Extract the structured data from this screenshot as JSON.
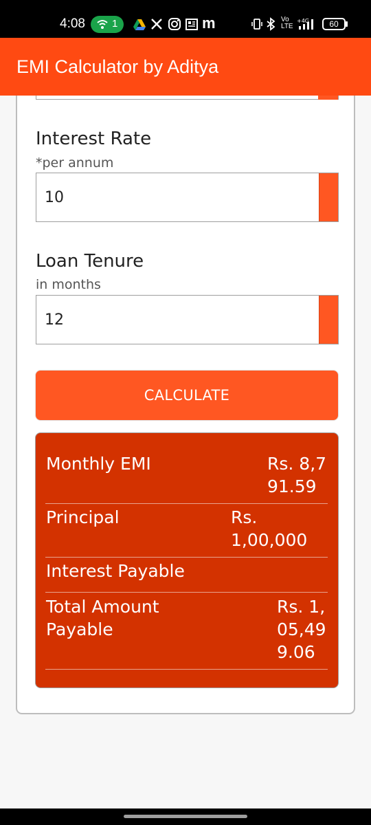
{
  "status_bar": {
    "time": "4:08",
    "wifi_count": "1",
    "battery": "60",
    "icons": [
      "wifi-icon",
      "drive-icon",
      "x-icon",
      "instagram-icon",
      "news-icon",
      "m-icon",
      "vibrate-icon",
      "bluetooth-icon",
      "volte-icon",
      "signal-icon",
      "battery-icon"
    ]
  },
  "app_bar": {
    "title": "EMI Calculator by Aditya"
  },
  "form": {
    "interest": {
      "label": "Interest Rate",
      "sublabel": "*per annum",
      "value": "10"
    },
    "tenure": {
      "label": "Loan Tenure",
      "sublabel": "in months",
      "value": "12"
    },
    "calculate_label": "CALCULATE"
  },
  "result": {
    "monthly_emi_label": "Monthly EMI",
    "monthly_emi_value": "Rs. 8,791.59",
    "principal_label": "Principal",
    "principal_value": "Rs. 1,00,000",
    "interest_label": "Interest Payable",
    "total_label": "Total Amount Payable",
    "total_value": "Rs. 1,05,499.06"
  },
  "colors": {
    "primary": "#ff4a12",
    "accent": "#ff5722",
    "result_bg": "#d33200"
  }
}
